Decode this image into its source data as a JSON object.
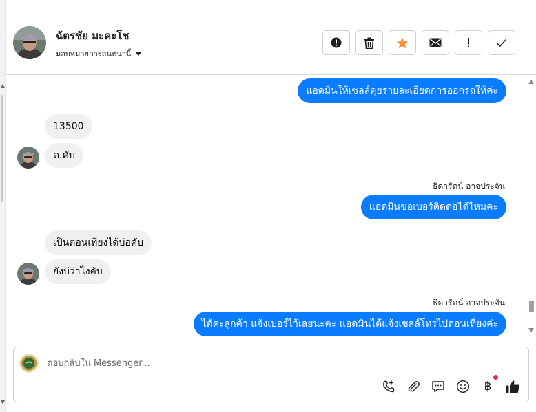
{
  "header": {
    "contact_name": "ฉัตรชัย มะคะโช",
    "assign_label": "มอบหมายการสนทนานี้",
    "toolbar": [
      {
        "icon": "alert-circle-icon",
        "label": "Mark as spam"
      },
      {
        "icon": "trash-icon",
        "label": "Delete"
      },
      {
        "icon": "star-icon",
        "label": "Star"
      },
      {
        "icon": "envelope-icon",
        "label": "Mark as unread"
      },
      {
        "icon": "exclamation-icon",
        "label": "Follow up"
      },
      {
        "icon": "check-icon",
        "label": "Done"
      }
    ]
  },
  "messages": {
    "m1": "แอดมินให้เซลล์คุยรายละเอียดการออกรถให้ค่ะ",
    "m2": "13500",
    "m3": "ด.คับ",
    "sender1": "ธิดารัตน์ อาจประจัน",
    "m4": "แอดมินขอเบอร์ติดต่อได้ไหมคะ",
    "m5": "เป็นตอนเที่ยงได้บ่อคับ",
    "m6": "ยังบ่ว่าไงคับ",
    "sender2": "ธิดารัตน์ อาจประจัน",
    "m7": "ได้ค่ะลูกค้า แจ้งเบอร์ไว้เลยนะคะ แอดมินได้แจ้งเซลล์โทรไปตอนเที่ยงค่ะ"
  },
  "composer": {
    "placeholder": "ตอบกลับใน Messenger...",
    "baht_symbol": "฿"
  },
  "colors": {
    "outgoing_bubble": "#0a7cff",
    "incoming_bubble": "#f0f0f0",
    "star": "#f7923b",
    "notification_dot": "#f02849"
  }
}
